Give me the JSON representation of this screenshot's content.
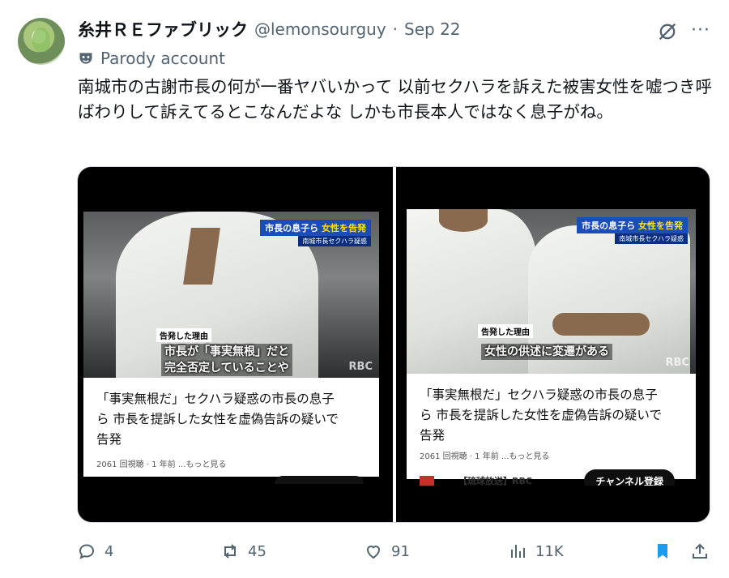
{
  "author": {
    "display_name": "糸井ＲＥファブリック",
    "handle": "@lemonsourguy",
    "date": "Sep 22",
    "separator": "·",
    "label": "Parody account"
  },
  "tweet": {
    "text": "南城市の古謝市長の何が一番ヤバいかって 以前セクハラを訴えた被害女性を嘘つき呼ばわりして訴えてるとこなんだよな しかも市長本人ではなく息子がね。"
  },
  "media": {
    "left": {
      "news_tag_prefix": "市長の息子ら ",
      "news_tag_highlight": "女性を告発",
      "news_sub": "南城市長セクハラ疑惑",
      "reason_tag": "告発した理由",
      "caption_lines": [
        "市長が「事実無根」だと",
        "完全否定していることや"
      ],
      "watermark": "RBC",
      "card_title_lines": [
        "「事実無根だ」セクハラ疑惑の市長の息子",
        "ら 市長を提訴した女性を虚偽告訴の疑いで",
        "告発"
      ],
      "card_meta": "2061 回視聴 · 1 年前   ...もっと見る"
    },
    "right": {
      "news_tag_prefix": "市長の息子ら ",
      "news_tag_highlight": "女性を告発",
      "news_sub": "南城市長セクハラ疑惑",
      "reason_tag": "告発した理由",
      "caption_lines": [
        "女性の供述に変遷がある"
      ],
      "watermark": "RBC",
      "card_title_lines": [
        "「事実無根だ」セクハラ疑惑の市長の息子",
        "ら 市長を提訴した女性を虚偽告訴の疑いで",
        "告発"
      ],
      "card_meta": "2061 回視聴 · 1 年前   ...もっと見る",
      "channel_name": "【琉球放送】RBC",
      "subscribe_label": "チャンネル登録"
    }
  },
  "actions": {
    "replies": "4",
    "reposts": "45",
    "likes": "91",
    "views": "11K"
  },
  "colors": {
    "text": "#0f1419",
    "muted": "#536471",
    "bookmark": "#1d9bf0"
  }
}
